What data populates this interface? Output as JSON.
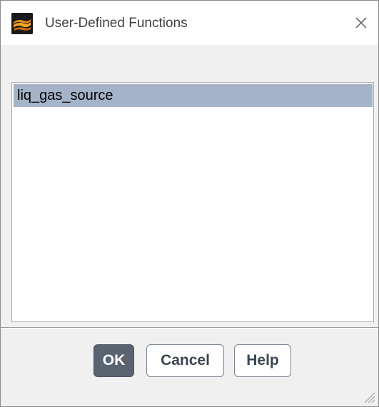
{
  "window": {
    "title": "User-Defined Functions",
    "app_icon": "fluent-app-icon",
    "close_icon": "close-icon"
  },
  "list": {
    "items": [
      {
        "label": "liq_gas_source",
        "selected": true
      }
    ],
    "selection_color": "#a4b3c8"
  },
  "buttons": {
    "ok_label": "OK",
    "cancel_label": "Cancel",
    "help_label": "Help",
    "primary_color": "#5a6370"
  },
  "resize_grip_icon": "resize-grip-icon"
}
